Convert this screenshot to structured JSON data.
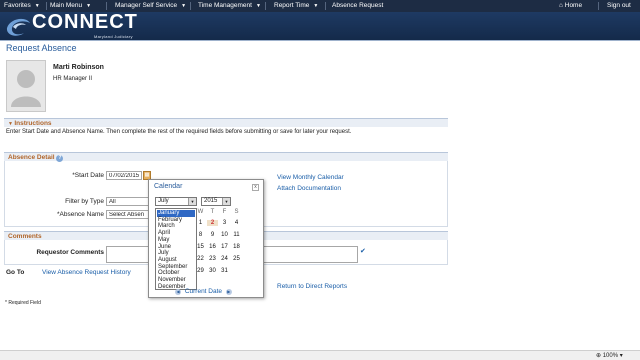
{
  "nav": {
    "items": [
      {
        "label": "Favorites"
      },
      {
        "label": "Main Menu"
      },
      {
        "label": "Manager Self Service"
      },
      {
        "label": "Time Management"
      },
      {
        "label": "Report Time"
      },
      {
        "label": "Absence Request"
      }
    ],
    "home": "Home",
    "signout": "Sign out"
  },
  "brand": {
    "name": "CONNECT",
    "sub": "Maryland Judiciary"
  },
  "page": {
    "title": "Request Absence"
  },
  "employee": {
    "name": "Marti Robinson",
    "title": "HR Manager II"
  },
  "instructions": {
    "header": "Instructions",
    "text": "Enter Start Date and Absence Name. Then complete the rest of the required fields before submitting or save for later your request."
  },
  "absence": {
    "header": "Absence Detail",
    "start_date_label": "*Start Date",
    "start_date_value": "07/02/2015",
    "filter_label": "Filter by Type",
    "filter_value": "All",
    "absence_name_label": "*Absence Name",
    "absence_name_value": "Select Absen",
    "view_calendar": "View Monthly Calendar",
    "attach": "Attach Documentation"
  },
  "comments": {
    "header": "Comments",
    "requestor_label": "Requestor Comments"
  },
  "goto": {
    "label": "Go To",
    "history_link": "View Absence Request History",
    "return_link": "Return to Direct Reports"
  },
  "required_note": "* Required Field",
  "calendar": {
    "title": "Calendar",
    "close": "x",
    "month_selected": "July",
    "year_selected": "2015",
    "months": [
      "January",
      "February",
      "March",
      "April",
      "May",
      "June",
      "July",
      "August",
      "September",
      "October",
      "November",
      "December"
    ],
    "highlighted_month": "January",
    "dow": [
      "W",
      "T",
      "F",
      "S"
    ],
    "weeks": [
      [
        "1",
        "2",
        "3",
        "4"
      ],
      [
        "8",
        "9",
        "10",
        "11"
      ],
      [
        "15",
        "16",
        "17",
        "18"
      ],
      [
        "22",
        "23",
        "24",
        "25"
      ],
      [
        "29",
        "30",
        "31",
        ""
      ]
    ],
    "today": "2",
    "current_date": "Current Date"
  },
  "zoom": "100%"
}
